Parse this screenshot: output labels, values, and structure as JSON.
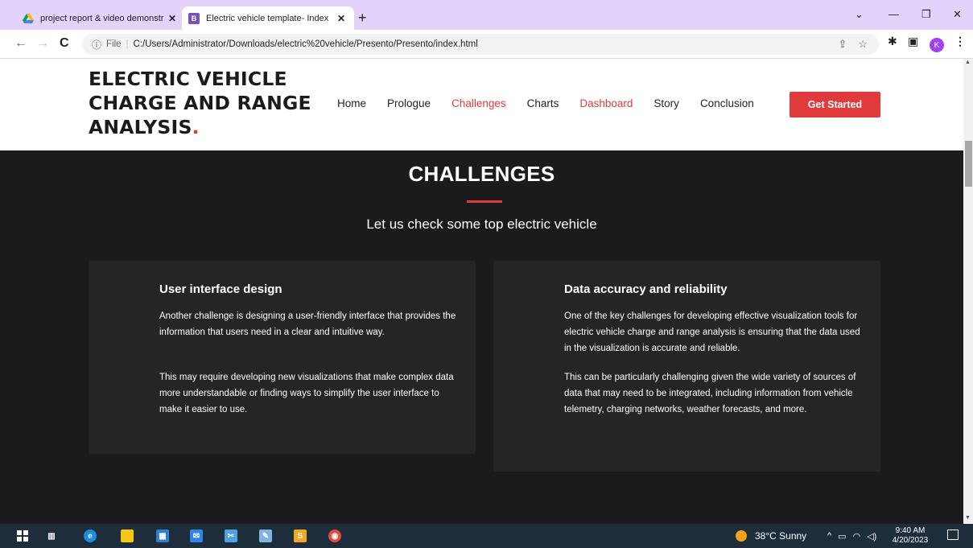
{
  "browser": {
    "tabs": [
      {
        "title": "project report & video demonstr",
        "active": false
      },
      {
        "title": "Electric vehicle template- Index",
        "active": true
      }
    ],
    "address": {
      "prefix": "File",
      "url": "C:/Users/Administrator/Downloads/electric%20vehicle/Presento/Presento/index.html"
    },
    "profile_initial": "K"
  },
  "site": {
    "logo_text": "ELECTRIC VEHICLE CHARGE AND RANGE ANALYSIS",
    "logo_dot": ".",
    "nav": [
      {
        "label": "Home",
        "highlight": false
      },
      {
        "label": "Prologue",
        "highlight": false
      },
      {
        "label": "Challenges",
        "highlight": true
      },
      {
        "label": "Charts",
        "highlight": false
      },
      {
        "label": "Dashboard",
        "highlight": true
      },
      {
        "label": "Story",
        "highlight": false
      },
      {
        "label": "Conclusion",
        "highlight": false
      }
    ],
    "cta_label": "Get Started",
    "accent_color": "#e03a3c"
  },
  "section": {
    "title": "CHALLENGES",
    "subtitle": "Let us check some top electric vehicle",
    "cards": [
      {
        "title": "User interface design",
        "p1": "Another challenge is designing a user-friendly interface that provides the information that users need in a clear and intuitive way.",
        "p2": "This may require developing new visualizations that make complex data more understandable or finding ways to simplify the user interface to make it easier to use."
      },
      {
        "title": "Data accuracy and reliability",
        "p1": "One of the key challenges for developing effective visualization tools for electric vehicle charge and range analysis is ensuring that the data used in the visualization is accurate and reliable.",
        "p2": "This can be particularly challenging given the wide variety of sources of data that may need to be integrated, including information from vehicle telemetry, charging networks, weather forecasts, and more."
      }
    ]
  },
  "taskbar": {
    "weather": "38°C  Sunny",
    "time": "9:40 AM",
    "date": "4/20/2023"
  }
}
